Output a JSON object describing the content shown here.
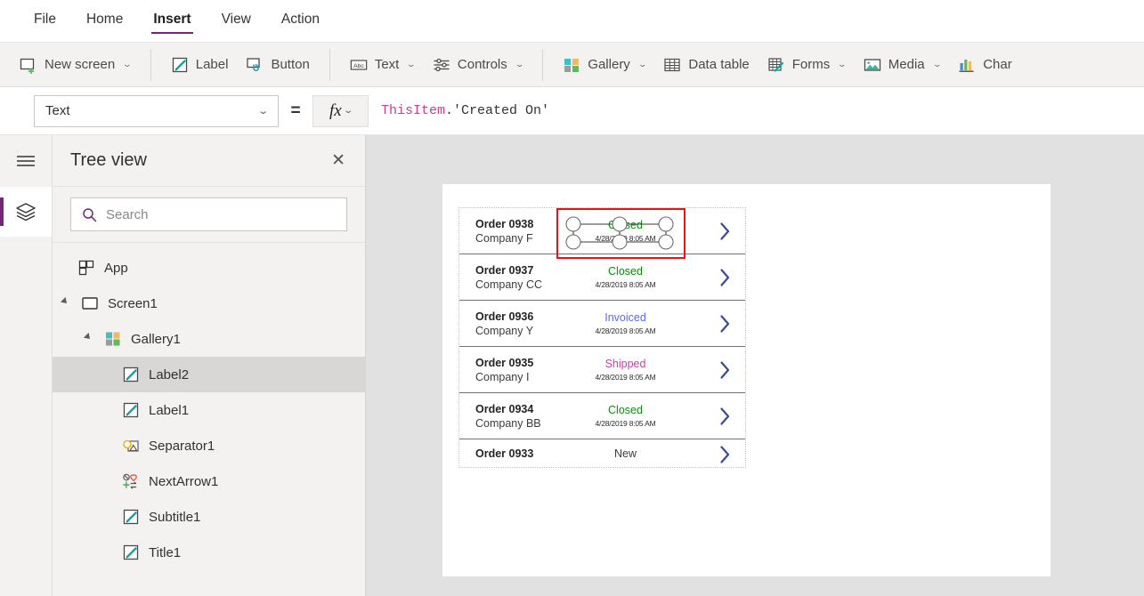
{
  "menubar": {
    "items": [
      {
        "label": "File",
        "active": false
      },
      {
        "label": "Home",
        "active": false
      },
      {
        "label": "Insert",
        "active": true
      },
      {
        "label": "View",
        "active": false
      },
      {
        "label": "Action",
        "active": false
      }
    ]
  },
  "ribbon": {
    "groups": [
      {
        "items": [
          {
            "label": "New screen",
            "icon": "new-screen-icon",
            "caret": true
          }
        ]
      },
      {
        "items": [
          {
            "label": "Label",
            "icon": "label-icon",
            "caret": false
          },
          {
            "label": "Button",
            "icon": "button-icon",
            "caret": false
          }
        ]
      },
      {
        "items": [
          {
            "label": "Text",
            "icon": "text-abc-icon",
            "caret": true
          },
          {
            "label": "Controls",
            "icon": "controls-sliders-icon",
            "caret": true
          }
        ]
      },
      {
        "items": [
          {
            "label": "Gallery",
            "icon": "gallery-grid-icon",
            "caret": true
          },
          {
            "label": "Data table",
            "icon": "data-table-icon",
            "caret": false
          },
          {
            "label": "Forms",
            "icon": "forms-icon",
            "caret": true
          },
          {
            "label": "Media",
            "icon": "media-image-icon",
            "caret": true
          },
          {
            "label": "Char",
            "icon": "chart-bar-icon",
            "caret": false
          }
        ]
      }
    ]
  },
  "formula_bar": {
    "property": "Text",
    "equals": "=",
    "fx": "fx",
    "formula_this": "ThisItem",
    "formula_rest": ".'Created On'"
  },
  "tree_panel": {
    "title": "Tree view",
    "close": "✕",
    "search_placeholder": "Search",
    "items": [
      {
        "label": "App",
        "icon": "app-icon",
        "indent": 0,
        "expander": false,
        "selected": false
      },
      {
        "label": "Screen1",
        "icon": "screen-icon",
        "indent": 0,
        "expander": true,
        "selected": false
      },
      {
        "label": "Gallery1",
        "icon": "gallery-icon",
        "indent": 1,
        "expander": true,
        "selected": false
      },
      {
        "label": "Label2",
        "icon": "label-icon",
        "indent": 2,
        "expander": false,
        "selected": true
      },
      {
        "label": "Label1",
        "icon": "label-icon",
        "indent": 2,
        "expander": false,
        "selected": false
      },
      {
        "label": "Separator1",
        "icon": "separator-icon",
        "indent": 2,
        "expander": false,
        "selected": false
      },
      {
        "label": "NextArrow1",
        "icon": "nextarrow-icon",
        "indent": 2,
        "expander": false,
        "selected": false
      },
      {
        "label": "Subtitle1",
        "icon": "label-icon",
        "indent": 2,
        "expander": false,
        "selected": false
      },
      {
        "label": "Title1",
        "icon": "label-icon",
        "indent": 2,
        "expander": false,
        "selected": false
      }
    ]
  },
  "canvas": {
    "gallery": {
      "rows": [
        {
          "title": "Order 0938",
          "subtitle": "Company F",
          "status": "Closed",
          "status_color": "#0e8a0e",
          "date": "4/28/2019 8:05 AM",
          "selected": true,
          "clipped": false
        },
        {
          "title": "Order 0937",
          "subtitle": "Company CC",
          "status": "Closed",
          "status_color": "#0e8a0e",
          "date": "4/28/2019 8:05 AM",
          "selected": false,
          "clipped": false
        },
        {
          "title": "Order 0936",
          "subtitle": "Company Y",
          "status": "Invoiced",
          "status_color": "#5a6ee0",
          "date": "4/28/2019 8:05 AM",
          "selected": false,
          "clipped": false
        },
        {
          "title": "Order 0935",
          "subtitle": "Company I",
          "status": "Shipped",
          "status_color": "#c740a8",
          "date": "4/28/2019 8:05 AM",
          "selected": false,
          "clipped": false
        },
        {
          "title": "Order 0934",
          "subtitle": "Company BB",
          "status": "Closed",
          "status_color": "#0e8a0e",
          "date": "4/28/2019 8:05 AM",
          "selected": false,
          "clipped": false
        },
        {
          "title": "Order 0933",
          "subtitle": "",
          "status": "New",
          "status_color": "#3b3b3b",
          "date": "",
          "selected": false,
          "clipped": true
        }
      ]
    }
  },
  "colors": {
    "accent_purple": "#742774",
    "selection_red": "#ee1111",
    "chevron_blue": "#3b4a9e",
    "row_divider": "#6a6f9a",
    "canvas_bg": "#e1e1e1",
    "panel_bg": "#f3f2f1"
  }
}
